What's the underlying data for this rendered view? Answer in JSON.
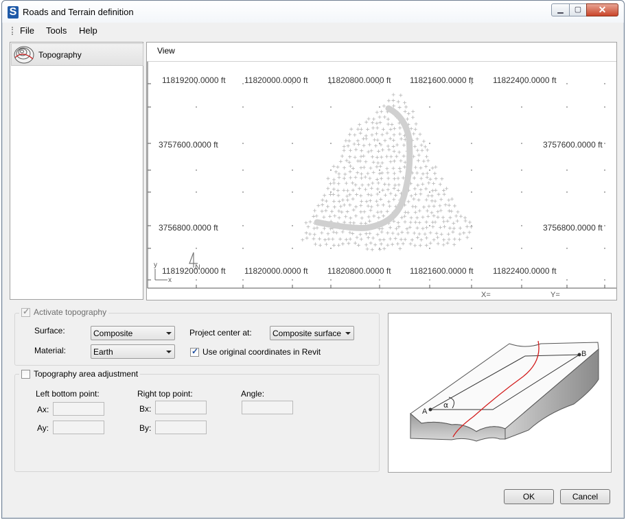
{
  "window": {
    "title": "Roads and Terrain definition"
  },
  "menu": {
    "file": "File",
    "tools": "Tools",
    "help": "Help"
  },
  "tree": {
    "topography": "Topography"
  },
  "view": {
    "label": "View",
    "top_x_labels": [
      "11819200.0000 ft",
      "11820000.0000 ft",
      "11820800.0000 ft",
      "11821600.0000 ft",
      "11822400.0000 ft"
    ],
    "bottom_x_labels": [
      "11819200.0000 ft",
      "11820000.0000 ft",
      "11820800.0000 ft",
      "11821600.0000 ft",
      "11822400.0000 ft"
    ],
    "left_y_labels": [
      "3757600.0000 ft",
      "3756800.0000 ft"
    ],
    "right_y_labels": [
      "3757600.0000 ft",
      "3756800.0000 ft"
    ],
    "x_readout": "X=",
    "y_readout": "Y=",
    "axis_y": "y",
    "axis_x": "x",
    "north": "N"
  },
  "topography": {
    "activate_label": "Activate topography",
    "surface_label": "Surface:",
    "surface_value": "Composite",
    "material_label": "Material:",
    "material_value": "Earth",
    "project_center_label": "Project center at:",
    "project_center_value": "Composite surface ge",
    "use_original_label": "Use original coordinates in Revit"
  },
  "area": {
    "label": "Topography area adjustment",
    "left_bottom_label": "Left bottom point:",
    "ax_label": "Ax:",
    "ay_label": "Ay:",
    "right_top_label": "Right top point:",
    "bx_label": "Bx:",
    "by_label": "By:",
    "angle_label": "Angle:"
  },
  "preview": {
    "point_a": "A",
    "point_b": "B",
    "alpha": "α"
  },
  "buttons": {
    "ok": "OK",
    "cancel": "Cancel"
  },
  "colors": {
    "road_curve": "#d0d0d0",
    "terrain_points": "#b5b5b5",
    "alignment": "#d21b1b"
  }
}
